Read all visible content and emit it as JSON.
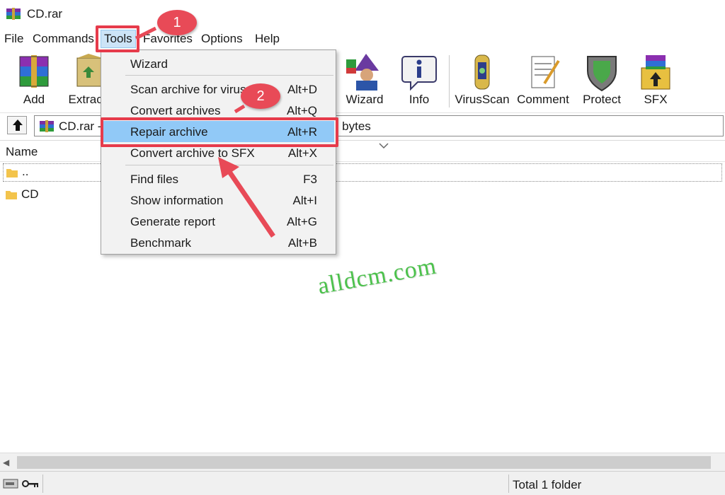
{
  "window": {
    "title": "CD.rar"
  },
  "menubar": {
    "items": [
      {
        "label": "File"
      },
      {
        "label": "Commands"
      },
      {
        "label": "Tools"
      },
      {
        "label": "Favorites"
      },
      {
        "label": "Options"
      },
      {
        "label": "Help"
      }
    ]
  },
  "toolbar": {
    "buttons": [
      {
        "label": "Add",
        "icon": "add-archive-icon"
      },
      {
        "label": "Extract",
        "icon": "extract-icon"
      },
      {
        "label": "Wizard",
        "icon": "wizard-icon"
      },
      {
        "label": "Info",
        "icon": "info-icon"
      },
      {
        "label": "VirusScan",
        "icon": "virusscan-icon"
      },
      {
        "label": "Comment",
        "icon": "comment-icon"
      },
      {
        "label": "Protect",
        "icon": "protect-icon"
      },
      {
        "label": "SFX",
        "icon": "sfx-icon"
      }
    ]
  },
  "addressbar": {
    "path": "CD.rar -",
    "size_tail": "4 bytes"
  },
  "filelist": {
    "column_name": "Name",
    "rows": [
      {
        "name": ".."
      },
      {
        "name": "CD"
      }
    ]
  },
  "tools_menu": {
    "items": [
      {
        "label": "Wizard",
        "shortcut": ""
      },
      {
        "label": "Scan archive for viruses",
        "shortcut": "Alt+D"
      },
      {
        "label": "Convert archives",
        "shortcut": "Alt+Q"
      },
      {
        "label": "Repair archive",
        "shortcut": "Alt+R"
      },
      {
        "label": "Convert archive to SFX",
        "shortcut": "Alt+X"
      },
      {
        "label": "Find files",
        "shortcut": "F3"
      },
      {
        "label": "Show information",
        "shortcut": "Alt+I"
      },
      {
        "label": "Generate report",
        "shortcut": "Alt+G"
      },
      {
        "label": "Benchmark",
        "shortcut": "Alt+B"
      }
    ],
    "highlighted": "Repair archive"
  },
  "statusbar": {
    "text": "Total 1 folder"
  },
  "annotations": {
    "badge1": "1",
    "badge2": "2",
    "watermark": "alldcm.com"
  },
  "colors": {
    "highlight": "#91c9f7",
    "annotation_red": "#e63b4b",
    "watermark_green": "#4cc24c"
  }
}
